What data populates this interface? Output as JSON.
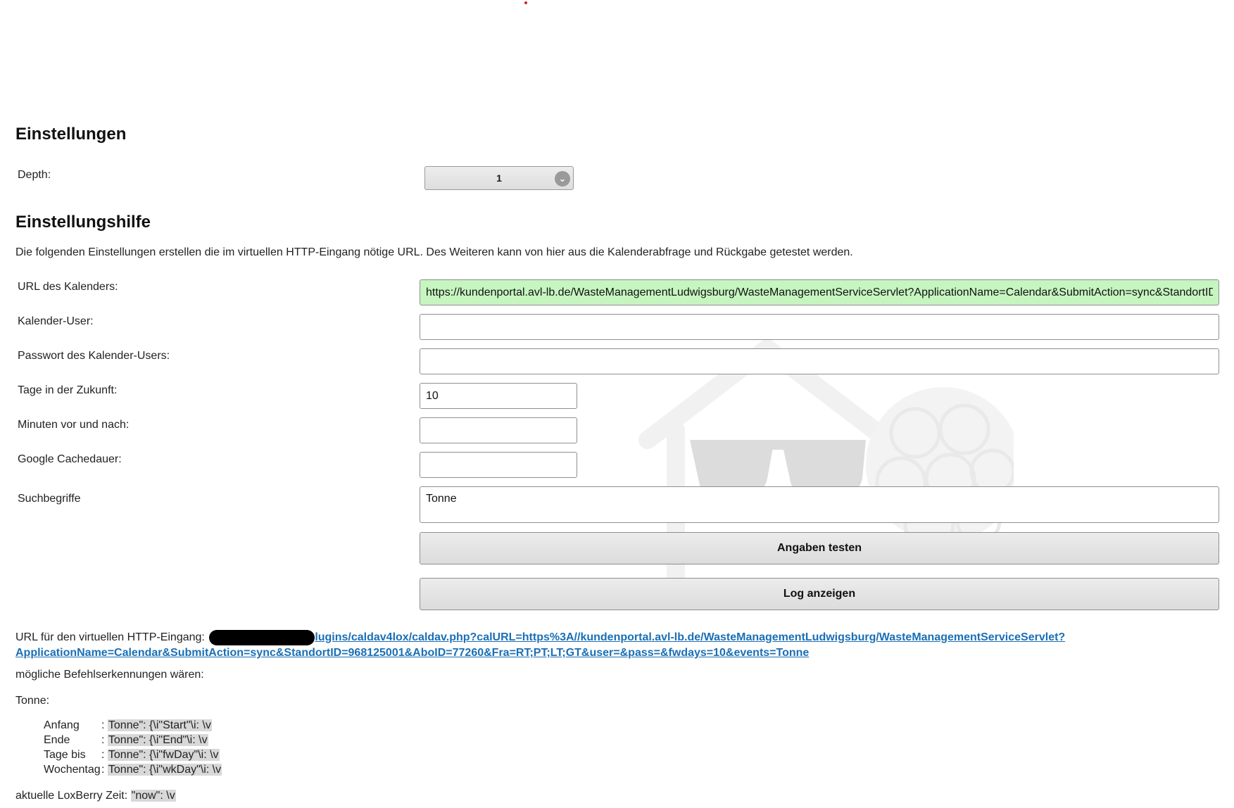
{
  "settings": {
    "heading": "Einstellungen",
    "depth_label": "Depth:",
    "depth_value": "1"
  },
  "help": {
    "heading": "Einstellungshilfe",
    "description": "Die folgenden Einstellungen erstellen die im virtuellen HTTP-Eingang nötige URL. Des Weiteren kann von hier aus die Kalenderabfrage und Rückgabe getestet werden."
  },
  "form": {
    "calendar_url_label": "URL des Kalenders:",
    "calendar_url_value": "https://kundenportal.avl-lb.de/WasteManagementLudwigsburg/WasteManagementServiceServlet?ApplicationName=Calendar&SubmitAction=sync&StandortID",
    "calendar_user_label": "Kalender-User:",
    "calendar_user_value": "",
    "calendar_password_label": "Passwort des Kalender-Users:",
    "calendar_password_value": "",
    "days_future_label": "Tage in der Zukunft:",
    "days_future_value": "10",
    "minutes_label": "Minuten vor und nach:",
    "minutes_value": "",
    "google_cache_label": "Google Cachedauer:",
    "google_cache_value": "",
    "search_terms_label": "Suchbegriffe",
    "search_terms_value": "Tonne",
    "test_button": "Angaben testen",
    "log_button": "Log anzeigen"
  },
  "http_input": {
    "label": "URL für den virtuellen HTTP-Eingang:",
    "link_line1": "lugins/caldav4lox/caldav.php?calURL=https%3A//kundenportal.avl-lb.de/WasteManagementLudwigsburg/WasteManagementServiceServlet?",
    "link_line2": "ApplicationName=Calendar&SubmitAction=sync&StandortID=968125001&AboID=77260&Fra=RT;PT;LT;GT&user=&pass=&fwdays=10&events=Tonne"
  },
  "commands": {
    "intro": "mögliche Befehlserkennungen wären:",
    "group": "Tonne:",
    "rows": [
      {
        "name": "Anfang",
        "code": "Tonne\": {\\i\"Start\"\\i: \\v"
      },
      {
        "name": "Ende",
        "code": "Tonne\": {\\i\"End\"\\i: \\v"
      },
      {
        "name": "Tage bis",
        "code": "Tonne\": {\\i\"fwDay\"\\i: \\v"
      },
      {
        "name": "Wochentag",
        "code": "Tonne\": {\\i\"wkDay\"\\i: \\v"
      }
    ],
    "time_label": "aktuelle LoxBerry Zeit:",
    "time_code": "\"now\": \\v"
  },
  "colors": {
    "url_field_bg": "#c6f5c0",
    "link": "#1a6fb5"
  }
}
